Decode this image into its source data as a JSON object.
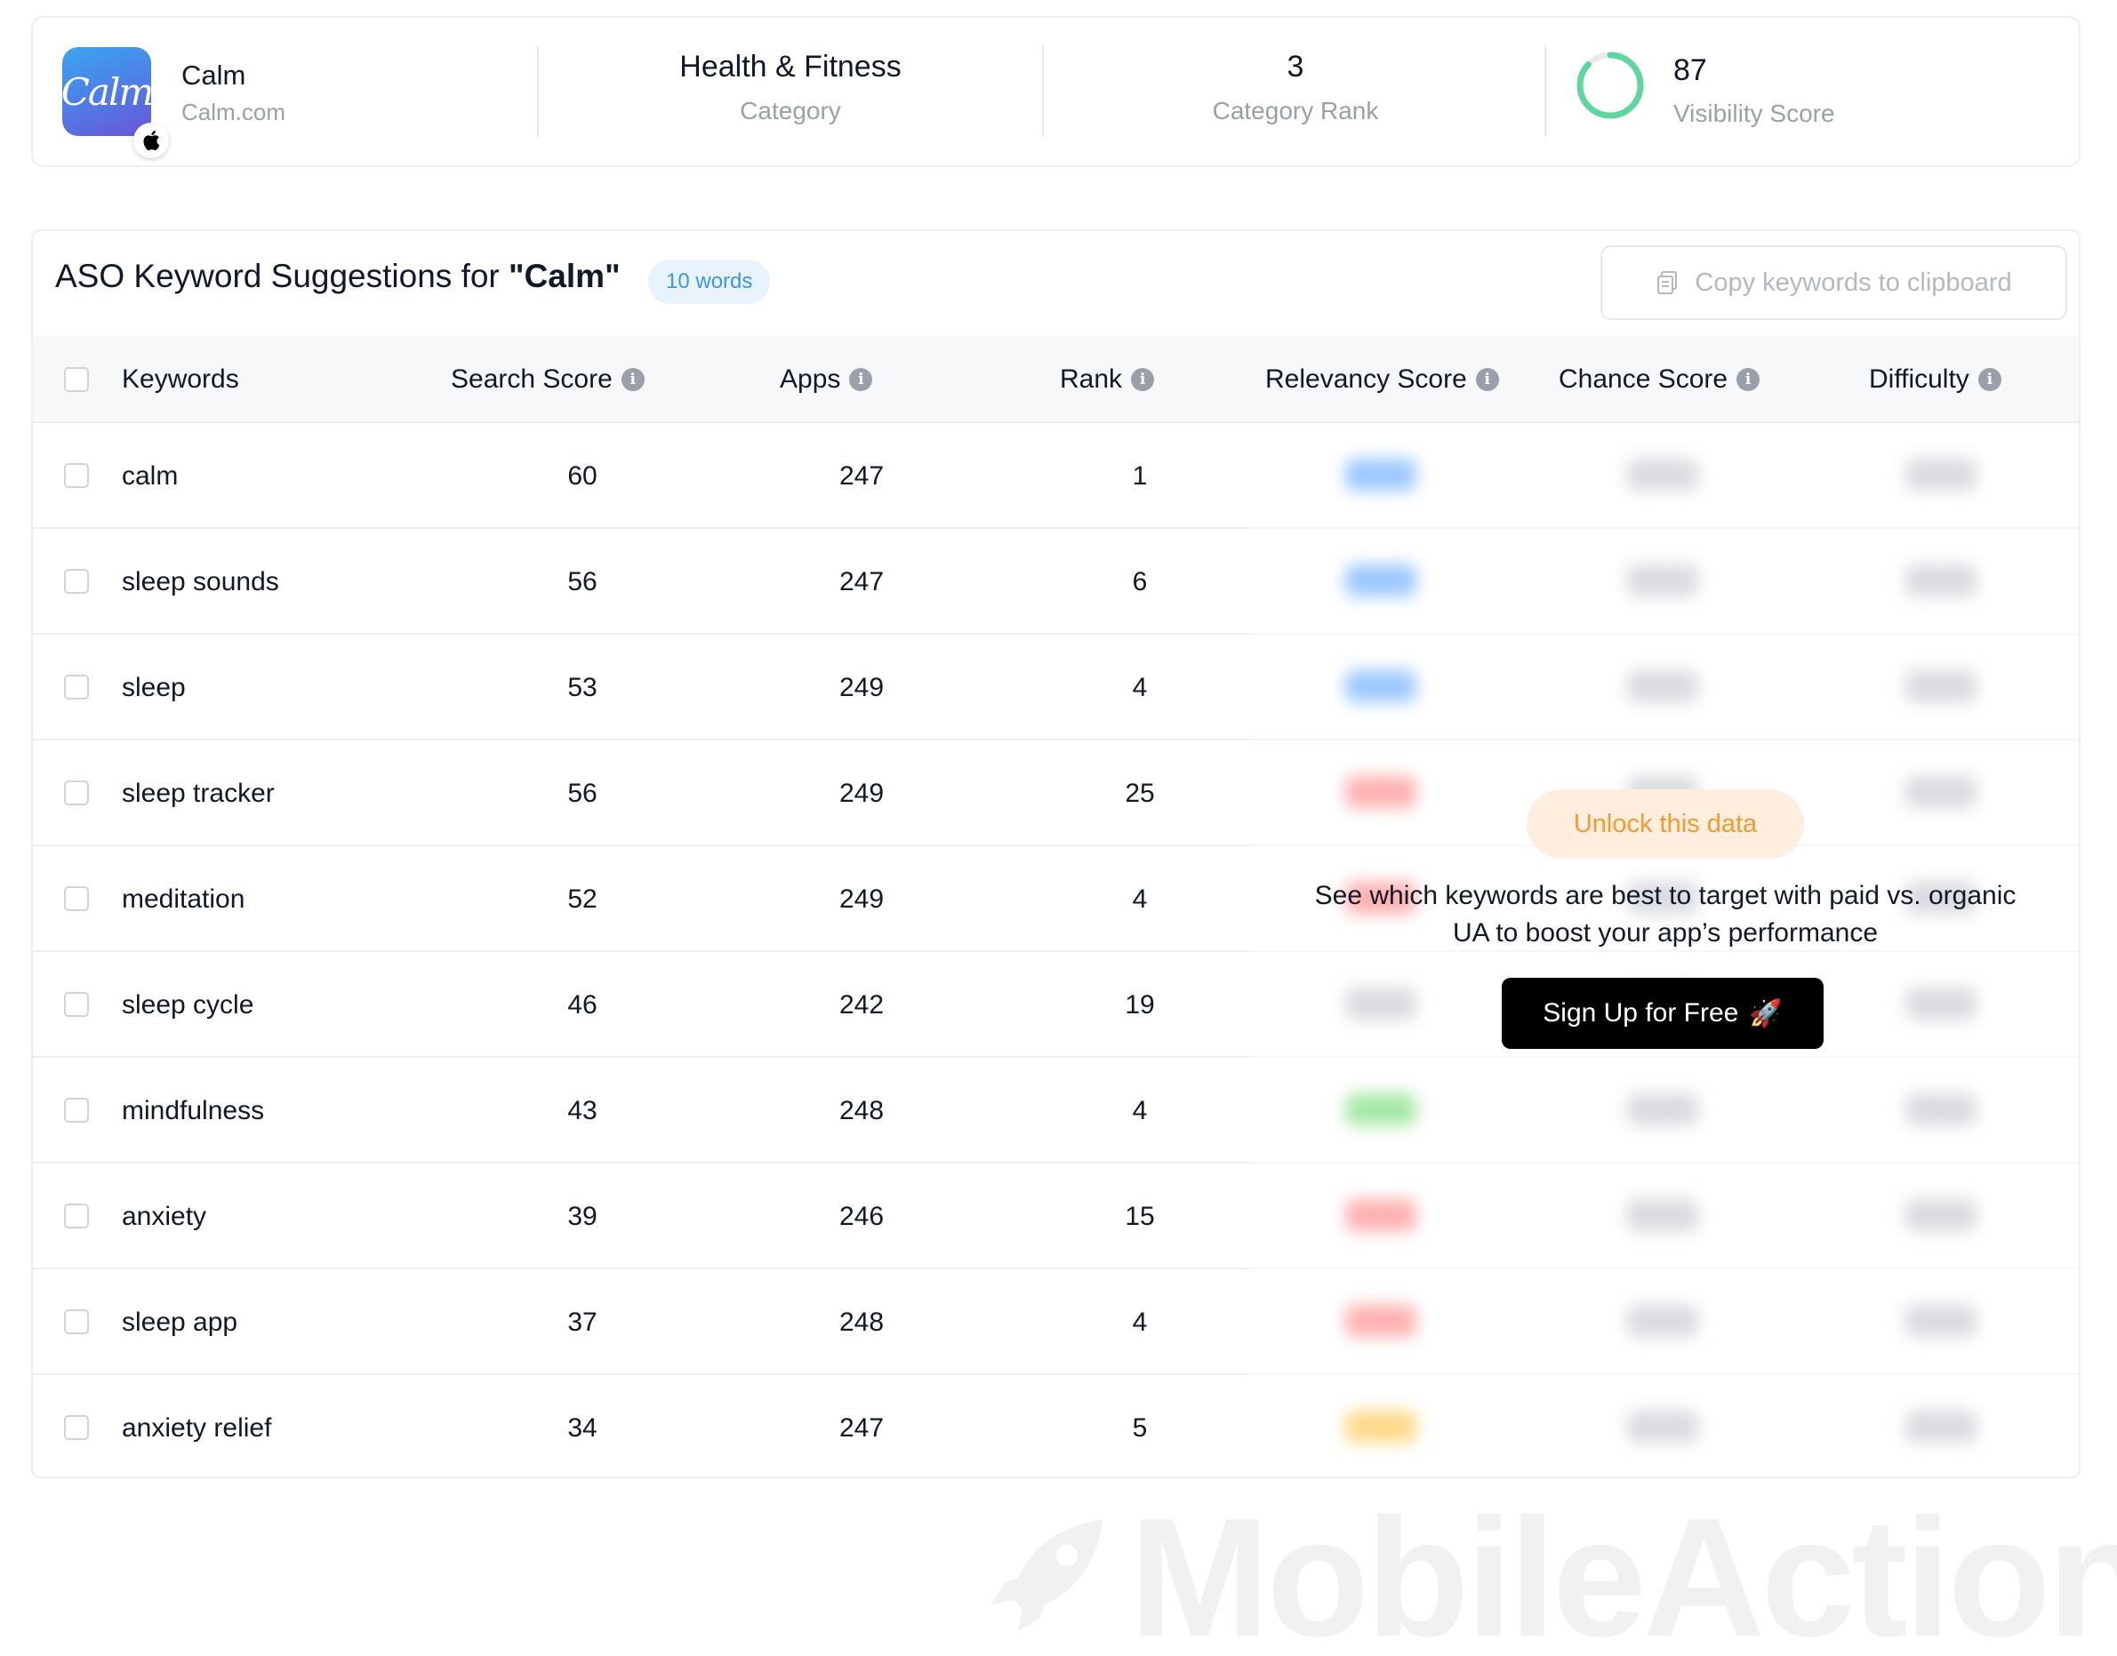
{
  "app": {
    "name": "Calm",
    "domain": "Calm.com",
    "logo_text": "Calm",
    "category_value": "Health & Fitness",
    "category_label": "Category",
    "rank_value": "3",
    "rank_label": "Category Rank",
    "visibility_value": "87",
    "visibility_label": "Visibility Score",
    "visibility_fraction": 0.87
  },
  "table": {
    "title_prefix": "ASO Keyword Suggestions for ",
    "title_app": "\"Calm\"",
    "words_badge": "10 words",
    "copy_label": "Copy keywords to clipboard",
    "columns": {
      "keywords": "Keywords",
      "search_score": "Search Score",
      "apps": "Apps",
      "rank": "Rank",
      "relevancy": "Relevancy Score",
      "chance": "Chance Score",
      "difficulty": "Difficulty"
    },
    "rows": [
      {
        "keyword": "calm",
        "search_score": "60",
        "apps": "247",
        "rank": "1",
        "relevancy_color": "#9cc8ff"
      },
      {
        "keyword": "sleep sounds",
        "search_score": "56",
        "apps": "247",
        "rank": "6",
        "relevancy_color": "#9cc8ff"
      },
      {
        "keyword": "sleep",
        "search_score": "53",
        "apps": "249",
        "rank": "4",
        "relevancy_color": "#9cc8ff"
      },
      {
        "keyword": "sleep tracker",
        "search_score": "56",
        "apps": "249",
        "rank": "25",
        "relevancy_color": "#ffb0b0"
      },
      {
        "keyword": "meditation",
        "search_score": "52",
        "apps": "249",
        "rank": "4",
        "relevancy_color": "#ffb0b0"
      },
      {
        "keyword": "sleep cycle",
        "search_score": "46",
        "apps": "242",
        "rank": "19",
        "relevancy_color": "#d9dbe0"
      },
      {
        "keyword": "mindfulness",
        "search_score": "43",
        "apps": "248",
        "rank": "4",
        "relevancy_color": "#a6e8a6"
      },
      {
        "keyword": "anxiety",
        "search_score": "39",
        "apps": "246",
        "rank": "15",
        "relevancy_color": "#ffb0b0"
      },
      {
        "keyword": "sleep app",
        "search_score": "37",
        "apps": "248",
        "rank": "4",
        "relevancy_color": "#ffb0b0"
      },
      {
        "keyword": "anxiety relief",
        "search_score": "34",
        "apps": "247",
        "rank": "5",
        "relevancy_color": "#ffd98a"
      }
    ]
  },
  "unlock": {
    "badge": "Unlock this data",
    "text": "See which keywords are best to target with paid vs. organic UA to boost your app’s performance",
    "signup_label": "Sign Up for Free",
    "signup_emoji": "🚀"
  },
  "watermark": {
    "text": "MobileAction"
  },
  "colors": {
    "accent_blue": "#3b95e9",
    "unlock_orange": "#f39a32",
    "ring_green": "#5fd6a0"
  },
  "icons": {
    "os": "apple-icon",
    "info": "info-icon",
    "copy": "copy-icon",
    "rocket": "rocket-icon"
  }
}
